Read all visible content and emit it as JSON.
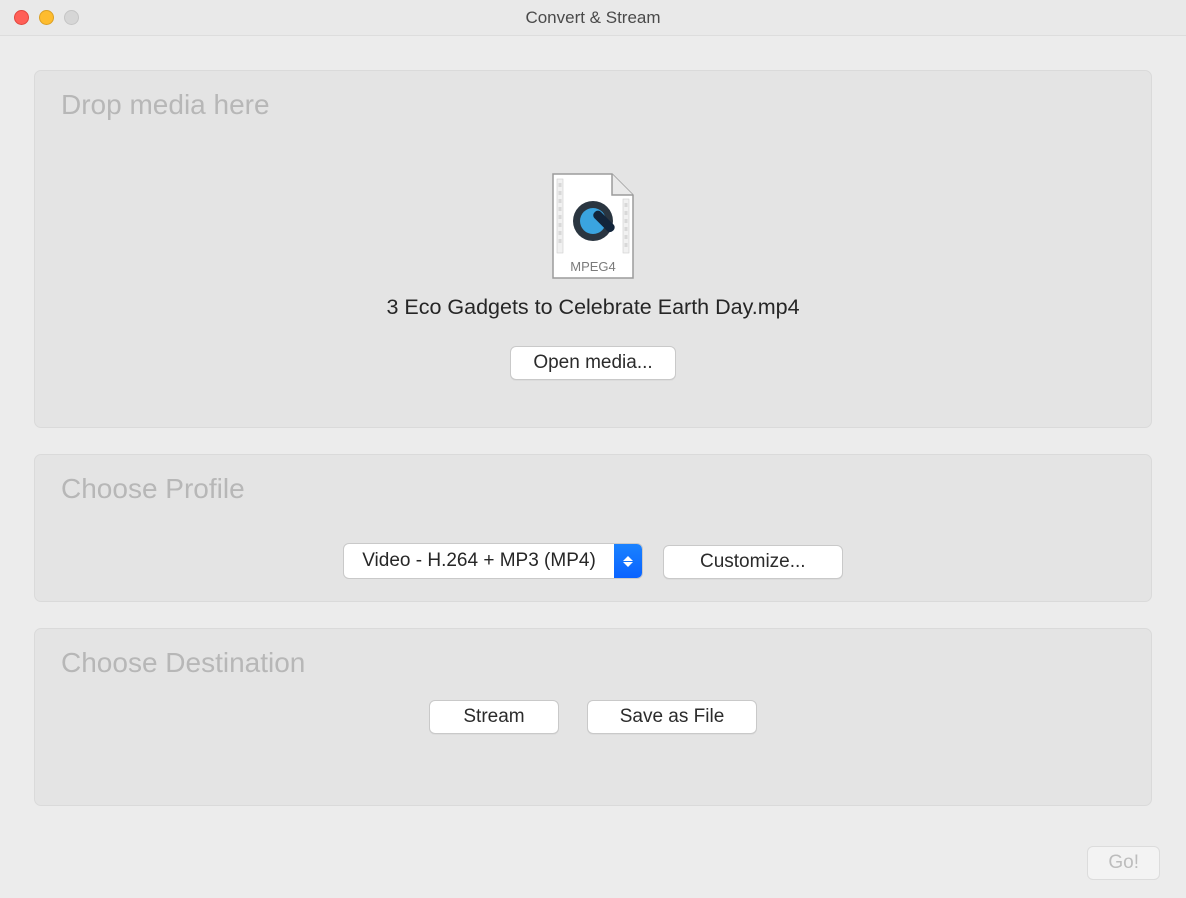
{
  "window": {
    "title": "Convert & Stream"
  },
  "drop": {
    "heading": "Drop media here",
    "file_type": "MPEG4",
    "filename": "3 Eco Gadgets to Celebrate Earth Day.mp4",
    "open_label": "Open media..."
  },
  "profile": {
    "heading": "Choose Profile",
    "selected": "Video - H.264 + MP3 (MP4)",
    "customize_label": "Customize..."
  },
  "destination": {
    "heading": "Choose Destination",
    "stream_label": "Stream",
    "save_label": "Save as File"
  },
  "footer": {
    "go_label": "Go!"
  }
}
